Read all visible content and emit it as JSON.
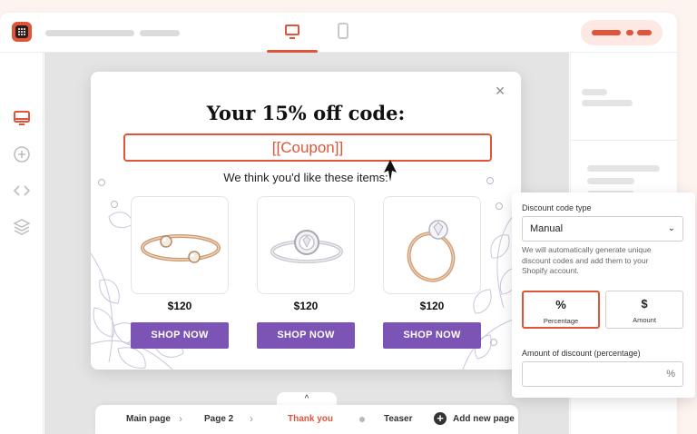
{
  "topbar": {
    "device_desktop_icon": "monitor-icon",
    "device_mobile_icon": "phone-icon"
  },
  "rail": {
    "icons": [
      "monitor-icon",
      "plus-circle-icon",
      "code-icon",
      "layers-icon"
    ]
  },
  "popup": {
    "title": "Your 15% off code:",
    "coupon_text": "[[Coupon]]",
    "subtitle": "We think you'd like these items:",
    "products": [
      {
        "price": "$120",
        "button": "SHOP NOW",
        "image": "ring-bypass"
      },
      {
        "price": "$120",
        "button": "SHOP NOW",
        "image": "ring-halo"
      },
      {
        "price": "$120",
        "button": "SHOP NOW",
        "image": "ring-solitaire"
      }
    ]
  },
  "bottom_nav": {
    "collapse_icon": "^",
    "pages": [
      "Main page",
      "Page 2",
      "Thank you",
      "Teaser"
    ],
    "active_page": "Thank you",
    "add_label": "Add new page",
    "add_icon": "+"
  },
  "discount": {
    "type_label": "Discount code type",
    "type_value": "Manual",
    "help_text": "We will automatically generate unique discount codes and add them to your Shopify account.",
    "options": [
      {
        "label": "Percentage",
        "icon": "%",
        "selected": true
      },
      {
        "label": "Amount",
        "icon": "$",
        "selected": false
      }
    ],
    "amount_label": "Amount of discount (percentage)",
    "amount_value": "",
    "amount_suffix": "%"
  },
  "colors": {
    "accent": "#e0553a",
    "button": "#7b54b5"
  }
}
